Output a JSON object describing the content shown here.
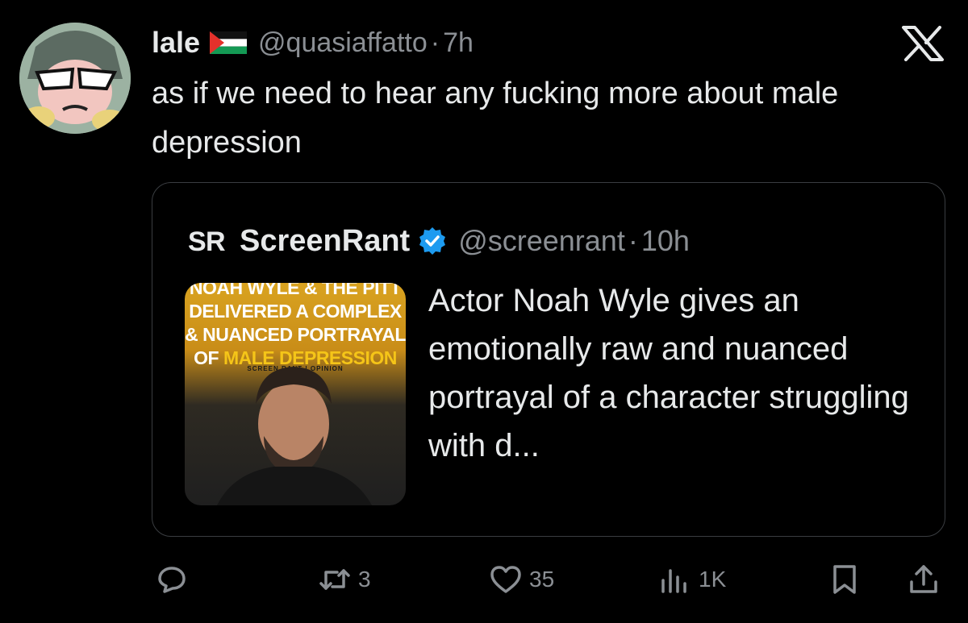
{
  "tweet": {
    "display_name": "lale",
    "handle": "@quasiaffatto",
    "separator": "·",
    "time": "7h",
    "text": "as if we need to hear any fucking more about male depression"
  },
  "quote": {
    "display_name": "ScreenRant",
    "handle": "@screenrant",
    "separator": "·",
    "time": "10h",
    "thumbnail": {
      "headline_line1": "NOAH WYLE & THE PITT",
      "headline_line2": "DELIVERED A COMPLEX",
      "headline_line3": "& NUANCED PORTRAYAL",
      "headline_line4_prefix": "OF",
      "headline_line4_highlight": "MALE DEPRESSION",
      "byline": "SCREEN RANT | OPINION"
    },
    "text": "Actor Noah Wyle gives an emotionally raw and nuanced portrayal of a character struggling with d..."
  },
  "actions": {
    "reply_count": "",
    "retweet_count": "3",
    "like_count": "35",
    "views_count": "1K"
  },
  "colors": {
    "background": "#000000",
    "primary_text": "#e7e9ea",
    "secondary_text": "#8b8f94",
    "verified_blue": "#1d9bf0",
    "thumbnail_yellow": "#f5c518"
  }
}
